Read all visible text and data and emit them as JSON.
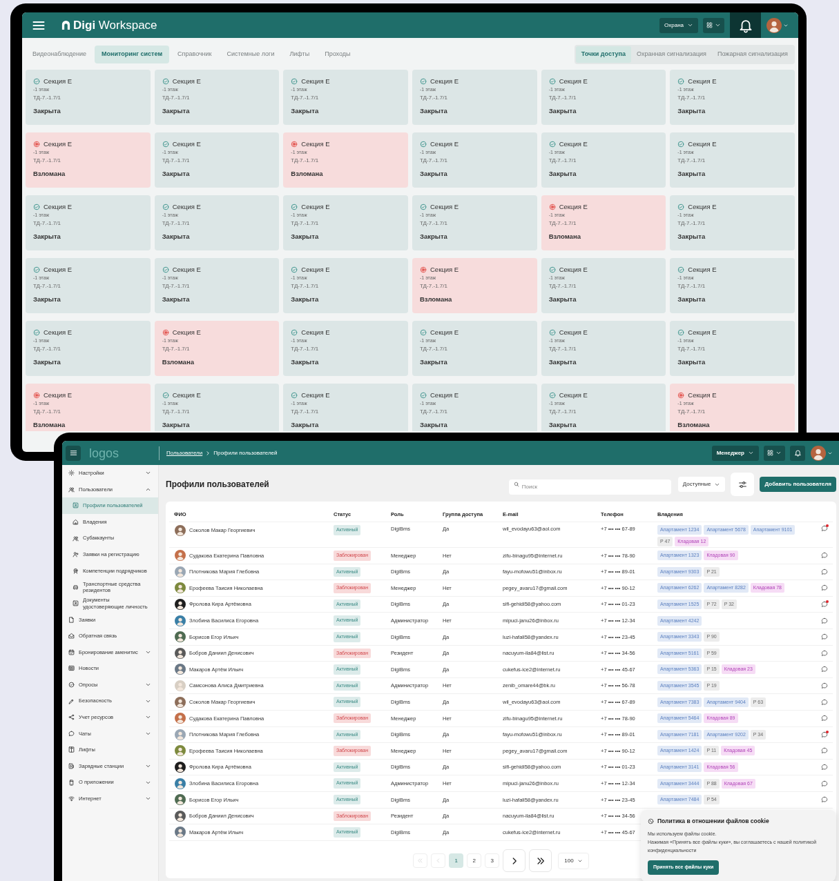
{
  "top_window": {
    "header": {
      "logo": "**Digi** Workspace",
      "role_dropdown": "Охрана"
    },
    "tabs": [
      {
        "label": "Видеонаблюдение",
        "selected": false
      },
      {
        "label": "Мониторинг систем",
        "selected": true
      },
      {
        "label": "Справочник",
        "selected": false
      },
      {
        "label": "Системные логи",
        "selected": false
      },
      {
        "label": "Лифты",
        "selected": false
      },
      {
        "label": "Проходы",
        "selected": false
      }
    ],
    "segments": [
      {
        "label": "Точки доступа",
        "selected": true
      },
      {
        "label": "Охранная сигнализация",
        "selected": false
      },
      {
        "label": "Пожарная сигнализация",
        "selected": false
      }
    ],
    "access_points": [
      {
        "name": "Секция Е",
        "floor": "-1 этаж",
        "code": "ТД-7.-1.7/1",
        "status": "Закрыта",
        "breached": false
      },
      {
        "name": "Секция Е",
        "floor": "-1 этаж",
        "code": "ТД-7.-1.7/1",
        "status": "Закрыта",
        "breached": false
      },
      {
        "name": "Секция Е",
        "floor": "-1 этаж",
        "code": "ТД-7.-1.7/1",
        "status": "Закрыта",
        "breached": false
      },
      {
        "name": "Секция Е",
        "floor": "-1 этаж",
        "code": "ТД-7.-1.7/1",
        "status": "Закрыта",
        "breached": false
      },
      {
        "name": "Секция Е",
        "floor": "-1 этаж",
        "code": "ТД-7.-1.7/1",
        "status": "Закрыта",
        "breached": false
      },
      {
        "name": "Секция Е",
        "floor": "-1 этаж",
        "code": "ТД-7.-1.7/1",
        "status": "Закрыта",
        "breached": false
      },
      {
        "name": "Секция Е",
        "floor": "-1 этаж",
        "code": "ТД-7.-1.7/1",
        "status": "Взломана",
        "breached": true
      },
      {
        "name": "Секция Е",
        "floor": "-1 этаж",
        "code": "ТД-7.-1.7/1",
        "status": "Закрыта",
        "breached": false
      },
      {
        "name": "Секция Е",
        "floor": "-1 этаж",
        "code": "ТД-7.-1.7/1",
        "status": "Взломана",
        "breached": true
      },
      {
        "name": "Секция Е",
        "floor": "-1 этаж",
        "code": "ТД-7.-1.7/1",
        "status": "Закрыта",
        "breached": false
      },
      {
        "name": "Секция Е",
        "floor": "-1 этаж",
        "code": "ТД-7.-1.7/1",
        "status": "Закрыта",
        "breached": false
      },
      {
        "name": "Секция Е",
        "floor": "-1 этаж",
        "code": "ТД-7.-1.7/1",
        "status": "Закрыта",
        "breached": false
      },
      {
        "name": "Секция Е",
        "floor": "-1 этаж",
        "code": "ТД-7.-1.7/1",
        "status": "Закрыта",
        "breached": false
      },
      {
        "name": "Секция Е",
        "floor": "-1 этаж",
        "code": "ТД-7.-1.7/1",
        "status": "Закрыта",
        "breached": false
      },
      {
        "name": "Секция Е",
        "floor": "-1 этаж",
        "code": "ТД-7.-1.7/1",
        "status": "Закрыта",
        "breached": false
      },
      {
        "name": "Секция Е",
        "floor": "-1 этаж",
        "code": "ТД-7.-1.7/1",
        "status": "Закрыта",
        "breached": false
      },
      {
        "name": "Секция Е",
        "floor": "-1 этаж",
        "code": "ТД-7.-1.7/1",
        "status": "Взломана",
        "breached": true
      },
      {
        "name": "Секция Е",
        "floor": "-1 этаж",
        "code": "ТД-7.-1.7/1",
        "status": "Закрыта",
        "breached": false
      },
      {
        "name": "Секция Е",
        "floor": "-1 этаж",
        "code": "ТД-7.-1.7/1",
        "status": "Закрыта",
        "breached": false
      },
      {
        "name": "Секция Е",
        "floor": "-1 этаж",
        "code": "ТД-7.-1.7/1",
        "status": "Закрыта",
        "breached": false
      },
      {
        "name": "Секция Е",
        "floor": "-1 этаж",
        "code": "ТД-7.-1.7/1",
        "status": "Закрыта",
        "breached": false
      },
      {
        "name": "Секция Е",
        "floor": "-1 этаж",
        "code": "ТД-7.-1.7/1",
        "status": "Взломана",
        "breached": true
      },
      {
        "name": "Секция Е",
        "floor": "-1 этаж",
        "code": "ТД-7.-1.7/1",
        "status": "Закрыта",
        "breached": false
      },
      {
        "name": "Секция Е",
        "floor": "-1 этаж",
        "code": "ТД-7.-1.7/1",
        "status": "Закрыта",
        "breached": false
      },
      {
        "name": "Секция Е",
        "floor": "-1 этаж",
        "code": "ТД-7.-1.7/1",
        "status": "Закрыта",
        "breached": false
      },
      {
        "name": "Секция Е",
        "floor": "-1 этаж",
        "code": "ТД-7.-1.7/1",
        "status": "Взломана",
        "breached": true
      },
      {
        "name": "Секция Е",
        "floor": "-1 этаж",
        "code": "ТД-7.-1.7/1",
        "status": "Закрыта",
        "breached": false
      },
      {
        "name": "Секция Е",
        "floor": "-1 этаж",
        "code": "ТД-7.-1.7/1",
        "status": "Закрыта",
        "breached": false
      },
      {
        "name": "Секция Е",
        "floor": "-1 этаж",
        "code": "ТД-7.-1.7/1",
        "status": "Закрыта",
        "breached": false
      },
      {
        "name": "Секция Е",
        "floor": "-1 этаж",
        "code": "ТД-7.-1.7/1",
        "status": "Закрыта",
        "breached": false
      },
      {
        "name": "Секция Е",
        "floor": "-1 этаж",
        "code": "ТД-7.-1.7/1",
        "status": "Взломана",
        "breached": true
      },
      {
        "name": "Секция Е",
        "floor": "-1 этаж",
        "code": "ТД-7.-1.7/1",
        "status": "Закрыта",
        "breached": false
      },
      {
        "name": "Секция Е",
        "floor": "-1 этаж",
        "code": "ТД-7.-1.7/1",
        "status": "Закрыта",
        "breached": false
      },
      {
        "name": "Секция Е",
        "floor": "-1 этаж",
        "code": "ТД-7.-1.7/1",
        "status": "Закрыта",
        "breached": false
      },
      {
        "name": "Секция Е",
        "floor": "-1 этаж",
        "code": "ТД-7.-1.7/1",
        "status": "Закрыта",
        "breached": false
      },
      {
        "name": "Секция Е",
        "floor": "-1 этаж",
        "code": "ТД-7.-1.7/1",
        "status": "Взломана",
        "breached": true
      }
    ]
  },
  "bottom_window": {
    "header": {
      "logo": "logos",
      "breadcrumb": [
        {
          "label": "Пользователи",
          "link": true
        },
        {
          "label": "Профили пользователей",
          "link": false
        }
      ],
      "role_dropdown": "Менеджер"
    },
    "sidebar": {
      "items": [
        {
          "label": "Настройки",
          "selected": false,
          "expanded": false
        },
        {
          "label": "Пользователи",
          "selected": false,
          "expanded": true,
          "children": [
            {
              "label": "Профили пользователей",
              "selected": true
            },
            {
              "label": "Владения",
              "selected": false
            },
            {
              "label": "Субаккаунты",
              "selected": false
            },
            {
              "label": "Заявки на регистрацию",
              "selected": false
            },
            {
              "label": "Компетенции подрядчиков",
              "selected": false
            },
            {
              "label": "Транспортные средства резидентов",
              "selected": false
            },
            {
              "label": "Документы удостоверяющие личность",
              "selected": false
            }
          ]
        },
        {
          "label": "Заявки",
          "selected": false
        },
        {
          "label": "Обратная связь",
          "selected": false
        },
        {
          "label": "Бронирование аменитис",
          "selected": false,
          "expanded": false
        },
        {
          "label": "Новости",
          "selected": false
        },
        {
          "label": "Опросы",
          "selected": false,
          "expanded": false
        },
        {
          "label": "Безопасность",
          "selected": false,
          "expanded": false
        },
        {
          "label": "Учет ресурсов",
          "selected": false,
          "expanded": false
        },
        {
          "label": "Чаты",
          "selected": false,
          "expanded": false
        },
        {
          "label": "Лифты",
          "selected": false
        },
        {
          "label": "Зарядные станции",
          "selected": false,
          "expanded": false
        },
        {
          "label": "О приложении",
          "selected": false,
          "expanded": false
        },
        {
          "label": "Интернет",
          "selected": false,
          "expanded": false
        }
      ]
    },
    "page_title": "Профили пользователей",
    "search": {
      "placeholder": "Поиск"
    },
    "filter_dropdown": "Доступные",
    "add_button": "Добавить пользователя",
    "table": {
      "columns": [
        "ФИО",
        "Статус",
        "Роль",
        "Группа доступа",
        "E-mail",
        "Телефон",
        "Владения"
      ],
      "rows": [
        {
          "name": "Соколов Макар Георгиевич",
          "status": {
            "label": "Активный",
            "kind": "active"
          },
          "role": "DigiBms",
          "access_group": "Да",
          "email": "wil_evodayu63@aol.com",
          "phone": "+7 ••• ••• 67-89",
          "holdings": [
            {
              "label": "Апартамент 1234",
              "kind": "apartment"
            },
            {
              "label": "Апартамент 5678",
              "kind": "apartment"
            },
            {
              "label": "Апартамент 9101",
              "kind": "apartment"
            },
            {
              "label": "P 47",
              "kind": "parking"
            },
            {
              "label": "Кладовая 12",
              "kind": "storage"
            }
          ],
          "chat": {
            "unread": true
          }
        },
        {
          "name": "Судакова Екатерина Павловна",
          "status": {
            "label": "Заблокирован",
            "kind": "blocked"
          },
          "role": "Менеджер",
          "access_group": "Нет",
          "email": "zifu-binagu95@internet.ru",
          "phone": "+7 ••• ••• 78-90",
          "holdings": [
            {
              "label": "Апартамент 1323",
              "kind": "apartment"
            },
            {
              "label": "Кладовая 90",
              "kind": "storage"
            }
          ],
          "chat": {
            "unread": false
          }
        },
        {
          "name": "Плотникова Мария Глебовна",
          "status": {
            "label": "Активный",
            "kind": "active"
          },
          "role": "DigiBms",
          "access_group": "Да",
          "email": "fayu-mofowu51@inbox.ru",
          "phone": "+7 ••• ••• 89-01",
          "holdings": [
            {
              "label": "Апартамент 9303",
              "kind": "apartment"
            },
            {
              "label": "P 21",
              "kind": "parking"
            }
          ],
          "chat": {
            "unread": false
          }
        },
        {
          "name": "Ерофеева Таисия Николаевна",
          "status": {
            "label": "Заблокирован",
            "kind": "blocked"
          },
          "role": "Менеджер",
          "access_group": "Нет",
          "email": "pegey_avaru17@gmail.com",
          "phone": "+7 ••• ••• 90-12",
          "holdings": [
            {
              "label": "Апартамент 6262",
              "kind": "apartment"
            },
            {
              "label": "Апартамент 8282",
              "kind": "apartment"
            },
            {
              "label": "Кладовая 78",
              "kind": "storage"
            }
          ],
          "chat": {
            "unread": false
          }
        },
        {
          "name": "Фролова Кира Артёмовна",
          "status": {
            "label": "Активный",
            "kind": "active"
          },
          "role": "DigiBms",
          "access_group": "Да",
          "email": "sifi-gehidi58@yahoo.com",
          "phone": "+7 ••• ••• 01-23",
          "holdings": [
            {
              "label": "Апартамент 1525",
              "kind": "apartment"
            },
            {
              "label": "P 72",
              "kind": "parking"
            },
            {
              "label": "P 32",
              "kind": "parking"
            }
          ],
          "chat": {
            "unread": true
          }
        },
        {
          "name": "Злобина Василиса Егоровна",
          "status": {
            "label": "Активный",
            "kind": "active"
          },
          "role": "Администратор",
          "access_group": "Нет",
          "email": "mipuci-janu26@inbox.ru",
          "phone": "+7 ••• ••• 12-34",
          "holdings": [
            {
              "label": "Апартамент 4242",
              "kind": "apartment"
            }
          ],
          "chat": {
            "unread": false
          }
        },
        {
          "name": "Борисов Егор Ильич",
          "status": {
            "label": "Активный",
            "kind": "active"
          },
          "role": "DigiBms",
          "access_group": "Да",
          "email": "luzi-hafali58@yandex.ru",
          "phone": "+7 ••• ••• 23-45",
          "holdings": [
            {
              "label": "Апартамент 3343",
              "kind": "apartment"
            },
            {
              "label": "P 90",
              "kind": "parking"
            }
          ],
          "chat": {
            "unread": false
          }
        },
        {
          "name": "Бобров Даниил Денисович",
          "status": {
            "label": "Заблокирован",
            "kind": "blocked"
          },
          "role": "Резидент",
          "access_group": "Да",
          "email": "nacuyum-ila84@list.ru",
          "phone": "+7 ••• ••• 34-56",
          "holdings": [
            {
              "label": "Апартамент 5161",
              "kind": "apartment"
            },
            {
              "label": "P 59",
              "kind": "parking"
            }
          ],
          "chat": {
            "unread": false
          }
        },
        {
          "name": "Макаров Артём Ильич",
          "status": {
            "label": "Активный",
            "kind": "active"
          },
          "role": "DigiBms",
          "access_group": "Да",
          "email": "cukefus-ice2@internet.ru",
          "phone": "+7 ••• ••• 45-67",
          "holdings": [
            {
              "label": "Апартамент 5363",
              "kind": "apartment"
            },
            {
              "label": "P 15",
              "kind": "parking"
            },
            {
              "label": "Кладовая 23",
              "kind": "storage"
            }
          ],
          "chat": {
            "unread": false
          }
        },
        {
          "name": "Самсонова Алиса Дмитриевна",
          "status": {
            "label": "Активный",
            "kind": "active"
          },
          "role": "Администратор",
          "access_group": "Нет",
          "email": "zenib_omare44@bk.ru",
          "phone": "+7 ••• ••• 56-78",
          "holdings": [
            {
              "label": "Апартамент 3545",
              "kind": "apartment"
            },
            {
              "label": "P 19",
              "kind": "parking"
            }
          ],
          "chat": {
            "unread": false
          }
        },
        {
          "name": "Соколов Макар Георгиевич",
          "status": {
            "label": "Активный",
            "kind": "active"
          },
          "role": "DigiBms",
          "access_group": "Да",
          "email": "wil_evodayu63@aol.com",
          "phone": "+7 ••• ••• 67-89",
          "holdings": [
            {
              "label": "Апартамент 7383",
              "kind": "apartment"
            },
            {
              "label": "Апартамент 9404",
              "kind": "apartment"
            },
            {
              "label": "P 63",
              "kind": "parking"
            }
          ],
          "chat": {
            "unread": false
          }
        },
        {
          "name": "Судакова Екатерина Павловна",
          "status": {
            "label": "Заблокирован",
            "kind": "blocked"
          },
          "role": "Менеджер",
          "access_group": "Нет",
          "email": "zifu-binagu95@internet.ru",
          "phone": "+7 ••• ••• 78-90",
          "holdings": [
            {
              "label": "Апартамент 5464",
              "kind": "apartment"
            },
            {
              "label": "Кладовая 89",
              "kind": "storage"
            }
          ],
          "chat": {
            "unread": false
          }
        },
        {
          "name": "Плотникова Мария Глебовна",
          "status": {
            "label": "Активный",
            "kind": "active"
          },
          "role": "DigiBms",
          "access_group": "Да",
          "email": "fayu-mofowu51@inbox.ru",
          "phone": "+7 ••• ••• 89-01",
          "holdings": [
            {
              "label": "Апартамент 7181",
              "kind": "apartment"
            },
            {
              "label": "Апартамент 9202",
              "kind": "apartment"
            },
            {
              "label": "P 34",
              "kind": "parking"
            }
          ],
          "chat": {
            "unread": true
          }
        },
        {
          "name": "Ерофеева Таисия Николаевна",
          "status": {
            "label": "Заблокирован",
            "kind": "blocked"
          },
          "role": "Менеджер",
          "access_group": "Нет",
          "email": "pegey_avaru17@gmail.com",
          "phone": "+7 ••• ••• 90-12",
          "holdings": [
            {
              "label": "Апартамент 1424",
              "kind": "apartment"
            },
            {
              "label": "P 11",
              "kind": "parking"
            },
            {
              "label": "Кладовая 45",
              "kind": "storage"
            }
          ],
          "chat": {
            "unread": false
          }
        },
        {
          "name": "Фролова Кира Артёмовна",
          "status": {
            "label": "Активный",
            "kind": "active"
          },
          "role": "DigiBms",
          "access_group": "Да",
          "email": "sifi-gehidi58@yahoo.com",
          "phone": "+7 ••• ••• 01-23",
          "holdings": [
            {
              "label": "Апартамент 3141",
              "kind": "apartment"
            },
            {
              "label": "Кладовая 56",
              "kind": "storage"
            }
          ],
          "chat": {
            "unread": false
          }
        },
        {
          "name": "Злобина Василиса Егоровна",
          "status": {
            "label": "Активный",
            "kind": "active"
          },
          "role": "Администратор",
          "access_group": "Нет",
          "email": "mipuci-janu26@inbox.ru",
          "phone": "+7 ••• ••• 12-34",
          "holdings": [
            {
              "label": "Апартамент 3444",
              "kind": "apartment"
            },
            {
              "label": "P 88",
              "kind": "parking"
            },
            {
              "label": "Кладовая 67",
              "kind": "storage"
            }
          ],
          "chat": {
            "unread": false
          }
        },
        {
          "name": "Борисов Егор Ильич",
          "status": {
            "label": "Активный",
            "kind": "active"
          },
          "role": "DigiBms",
          "access_group": "Да",
          "email": "luzi-hafali58@yandex.ru",
          "phone": "+7 ••• ••• 23-45",
          "holdings": [
            {
              "label": "Апартамент 7484",
              "kind": "apartment"
            },
            {
              "label": "P 54",
              "kind": "parking"
            }
          ],
          "chat": {
            "unread": false
          }
        },
        {
          "name": "Бобров Даниил Денисович",
          "status": {
            "label": "Заблокирован",
            "kind": "blocked"
          },
          "role": "Резидент",
          "access_group": "Да",
          "email": "nacuyum-ila84@list.ru",
          "phone": "+7 ••• ••• 34-56"
        },
        {
          "name": "Макаров Артём Ильич",
          "status": {
            "label": "Активный",
            "kind": "active"
          },
          "role": "DigiBms",
          "access_group": "Да",
          "email": "cukefus-ice2@internet.ru",
          "phone": "+7 ••• ••• 45-67"
        }
      ]
    },
    "pagination": {
      "back": [
        {
          "kind": "first",
          "disabled": true
        },
        {
          "kind": "prev",
          "disabled": true
        }
      ],
      "pages": [
        {
          "label": "1",
          "selected": true
        },
        {
          "label": "2",
          "selected": false
        },
        {
          "label": "3",
          "selected": false
        }
      ],
      "forward": [
        {
          "kind": "next",
          "disabled": false
        },
        {
          "kind": "last",
          "disabled": false
        }
      ],
      "page_size": "100"
    },
    "cookie_banner": {
      "title": "Политика в отношении файлов cookie",
      "lines": [
        "Мы используем файлы cookie.",
        "Нажимая «Принять все файлы куки», вы соглашаетесь с нашей политикой конфиденциальности"
      ],
      "button": "Принять все файлы куки"
    }
  }
}
